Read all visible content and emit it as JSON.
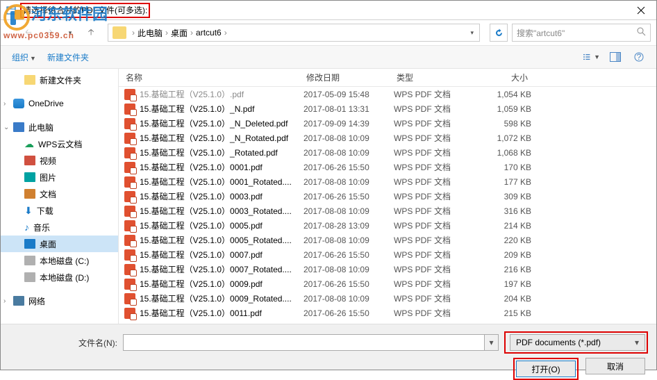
{
  "title": "请选择待合并的PDF文件(可多选):",
  "watermark": {
    "text": "河东软件园",
    "url": "www.pc0359.cn"
  },
  "breadcrumb": {
    "pc": "此电脑",
    "desktop": "桌面",
    "folder": "artcut6"
  },
  "search": {
    "placeholder": "搜索\"artcut6\""
  },
  "toolbar": {
    "organize": "组织",
    "newfolder": "新建文件夹"
  },
  "headers": {
    "name": "名称",
    "date": "修改日期",
    "type": "类型",
    "size": "大小"
  },
  "sidebar": {
    "newfolder": "新建文件夹",
    "onedrive": "OneDrive",
    "thispc": "此电脑",
    "wpscloud": "WPS云文档",
    "video": "视频",
    "pictures": "图片",
    "documents": "文档",
    "downloads": "下载",
    "music": "音乐",
    "desktop": "桌面",
    "diskc": "本地磁盘 (C:)",
    "diskd": "本地磁盘 (D:)",
    "network": "网络"
  },
  "files": [
    {
      "name": "15.基础工程（V25.1.0）.pdf",
      "date": "2017-05-09 15:48",
      "type": "WPS PDF 文档",
      "size": "1,054 KB",
      "cut": true
    },
    {
      "name": "15.基础工程（V25.1.0）_N.pdf",
      "date": "2017-08-01 13:31",
      "type": "WPS PDF 文档",
      "size": "1,059 KB"
    },
    {
      "name": "15.基础工程（V25.1.0）_N_Deleted.pdf",
      "date": "2017-09-09 14:39",
      "type": "WPS PDF 文档",
      "size": "598 KB"
    },
    {
      "name": "15.基础工程（V25.1.0）_N_Rotated.pdf",
      "date": "2017-08-08 10:09",
      "type": "WPS PDF 文档",
      "size": "1,072 KB"
    },
    {
      "name": "15.基础工程（V25.1.0）_Rotated.pdf",
      "date": "2017-08-08 10:09",
      "type": "WPS PDF 文档",
      "size": "1,068 KB"
    },
    {
      "name": "15.基础工程（V25.1.0）0001.pdf",
      "date": "2017-06-26 15:50",
      "type": "WPS PDF 文档",
      "size": "170 KB"
    },
    {
      "name": "15.基础工程（V25.1.0）0001_Rotated....",
      "date": "2017-08-08 10:09",
      "type": "WPS PDF 文档",
      "size": "177 KB"
    },
    {
      "name": "15.基础工程（V25.1.0）0003.pdf",
      "date": "2017-06-26 15:50",
      "type": "WPS PDF 文档",
      "size": "309 KB"
    },
    {
      "name": "15.基础工程（V25.1.0）0003_Rotated....",
      "date": "2017-08-08 10:09",
      "type": "WPS PDF 文档",
      "size": "316 KB"
    },
    {
      "name": "15.基础工程（V25.1.0）0005.pdf",
      "date": "2017-08-28 13:09",
      "type": "WPS PDF 文档",
      "size": "214 KB"
    },
    {
      "name": "15.基础工程（V25.1.0）0005_Rotated....",
      "date": "2017-08-08 10:09",
      "type": "WPS PDF 文档",
      "size": "220 KB"
    },
    {
      "name": "15.基础工程（V25.1.0）0007.pdf",
      "date": "2017-06-26 15:50",
      "type": "WPS PDF 文档",
      "size": "209 KB"
    },
    {
      "name": "15.基础工程（V25.1.0）0007_Rotated....",
      "date": "2017-08-08 10:09",
      "type": "WPS PDF 文档",
      "size": "216 KB"
    },
    {
      "name": "15.基础工程（V25.1.0）0009.pdf",
      "date": "2017-06-26 15:50",
      "type": "WPS PDF 文档",
      "size": "197 KB"
    },
    {
      "name": "15.基础工程（V25.1.0）0009_Rotated....",
      "date": "2017-08-08 10:09",
      "type": "WPS PDF 文档",
      "size": "204 KB"
    },
    {
      "name": "15.基础工程（V25.1.0）0011.pdf",
      "date": "2017-06-26 15:50",
      "type": "WPS PDF 文档",
      "size": "215 KB"
    }
  ],
  "bottom": {
    "filename_label": "文件名(N):",
    "filter": "PDF documents (*.pdf)",
    "open": "打开(O)",
    "cancel": "取消"
  }
}
